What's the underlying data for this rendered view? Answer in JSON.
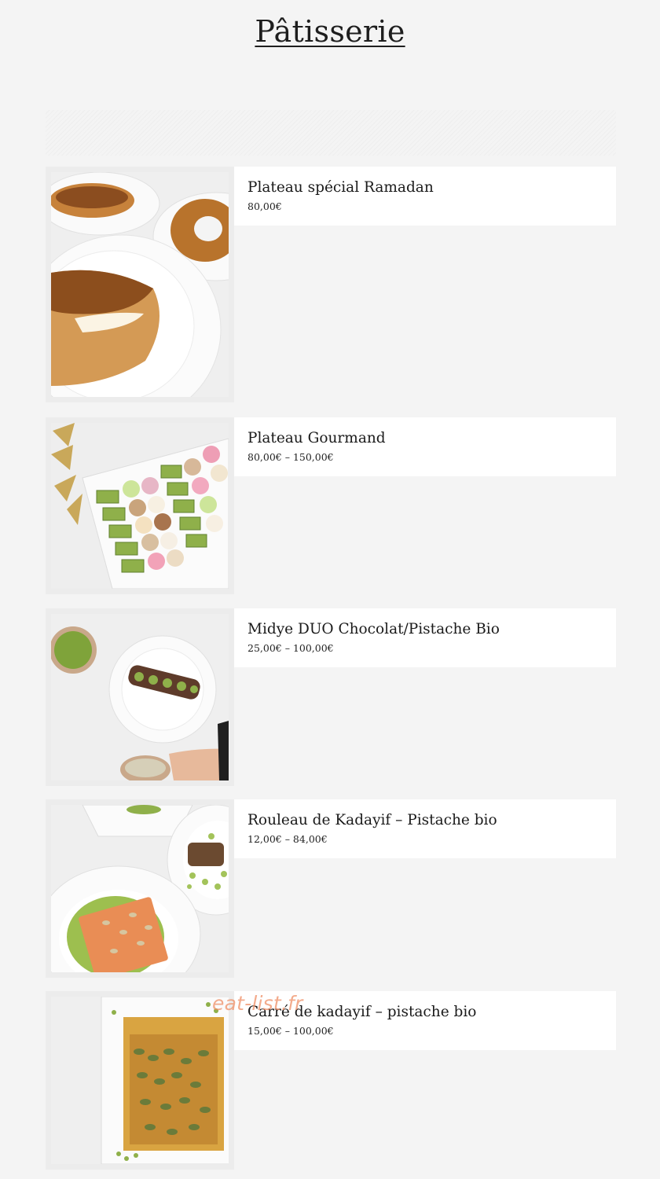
{
  "page": {
    "title": "Pâtisserie"
  },
  "products": [
    {
      "name": "Plateau spécial Ramadan",
      "price": "80,00€",
      "image_icon": "ramadan-bread-platter-photo"
    },
    {
      "name": "Plateau Gourmand",
      "price": "80,00€ – 150,00€",
      "image_icon": "gourmand-pastry-tray-photo"
    },
    {
      "name": "Midye DUO Chocolat/Pistache Bio",
      "price": "25,00€ – 100,00€",
      "image_icon": "midye-pistachio-chocolate-photo"
    },
    {
      "name": "Rouleau de Kadayif – Pistache bio",
      "price": "12,00€ – 84,00€",
      "image_icon": "kadayif-roll-photo"
    },
    {
      "name": "Carré de kadayif – pistache bio",
      "price": "15,00€ – 100,00€",
      "image_icon": "kadayif-square-photo"
    }
  ],
  "watermark": {
    "text": "eat-list.fr"
  },
  "colors": {
    "background": "#f4f4f4",
    "card": "#ffffff",
    "text": "#1e1e1e",
    "pistachio": "#8fb04a",
    "pastry": "#c98b3d",
    "watermark": "#ee8a60"
  }
}
